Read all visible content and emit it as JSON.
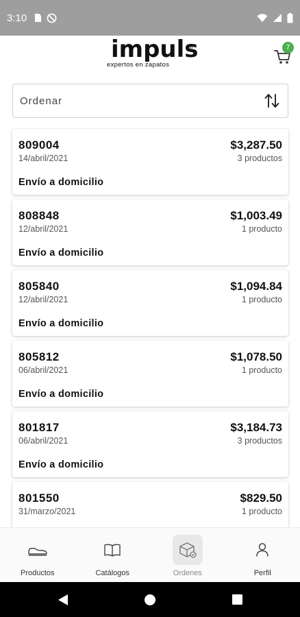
{
  "status_bar": {
    "time": "3:10"
  },
  "header": {
    "logo_word": "impuls",
    "logo_reg": "®",
    "logo_tagline": "expertos en zapatos",
    "cart_count": "7"
  },
  "sort": {
    "label": "Ordenar"
  },
  "orders": [
    {
      "id": "809004",
      "date": "14/abril/2021",
      "total": "$3,287.50",
      "count": "3 productos",
      "shipping": "Envío a domicilio"
    },
    {
      "id": "808848",
      "date": "12/abril/2021",
      "total": "$1,003.49",
      "count": "1 producto",
      "shipping": "Envío a domicilio"
    },
    {
      "id": "805840",
      "date": "12/abril/2021",
      "total": "$1,094.84",
      "count": "1 producto",
      "shipping": "Envío a domicilio"
    },
    {
      "id": "805812",
      "date": "06/abril/2021",
      "total": "$1,078.50",
      "count": "1 producto",
      "shipping": "Envío a domicilio"
    },
    {
      "id": "801817",
      "date": "06/abril/2021",
      "total": "$3,184.73",
      "count": "3 productos",
      "shipping": "Envío a domicilio"
    },
    {
      "id": "801550",
      "date": "31/marzo/2021",
      "total": "$829.50",
      "count": "1 producto",
      "shipping": ""
    }
  ],
  "bottom_nav": {
    "items": [
      {
        "label": "Productos",
        "icon": "shoe-icon",
        "active": false
      },
      {
        "label": "Catálogos",
        "icon": "book-icon",
        "active": false
      },
      {
        "label": "Ordenes",
        "icon": "box-icon",
        "active": true
      },
      {
        "label": "Perfil",
        "icon": "person-icon",
        "active": false
      }
    ]
  },
  "colors": {
    "status_bar": "#9e9e9e",
    "badge": "#4caf50",
    "active_nav_bg": "#e8e8e8"
  }
}
